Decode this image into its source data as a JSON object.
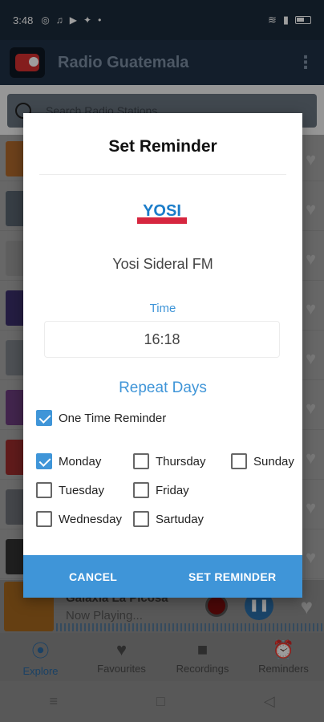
{
  "status_bar": {
    "time": "3:48"
  },
  "app_bar": {
    "title": "Radio Guatemala"
  },
  "search": {
    "placeholder": "Search Radio Stations"
  },
  "player": {
    "title": "Galaxia La Picosa",
    "subtitle": "Now Playing..."
  },
  "bottom_nav": {
    "items": [
      {
        "label": "Explore",
        "icon": "radio-tower-icon"
      },
      {
        "label": "Favourites",
        "icon": "heart-icon"
      },
      {
        "label": "Recordings",
        "icon": "video-camera-icon"
      },
      {
        "label": "Reminders",
        "icon": "alarm-clock-icon"
      }
    ]
  },
  "dialog": {
    "title": "Set Reminder",
    "station_logo_text": "YOSI",
    "station_name": "Yosi Sideral FM",
    "time_label": "Time",
    "time_value": "16:18",
    "repeat_title": "Repeat Days",
    "one_time": {
      "label": "One Time Reminder",
      "checked": true
    },
    "days": [
      {
        "label": "Monday",
        "checked": true
      },
      {
        "label": "Thursday",
        "checked": false
      },
      {
        "label": "Sunday",
        "checked": false
      },
      {
        "label": "Tuesday",
        "checked": false
      },
      {
        "label": "Friday",
        "checked": false
      },
      {
        "label": "Wednesday",
        "checked": false
      },
      {
        "label": "Sartuday",
        "checked": false
      }
    ],
    "cancel_label": "CANCEL",
    "set_label": "SET REMINDER"
  },
  "colors": {
    "accent": "#3f95d8",
    "app_bar": "#1f3146",
    "status_bar": "#1b2a3a"
  }
}
